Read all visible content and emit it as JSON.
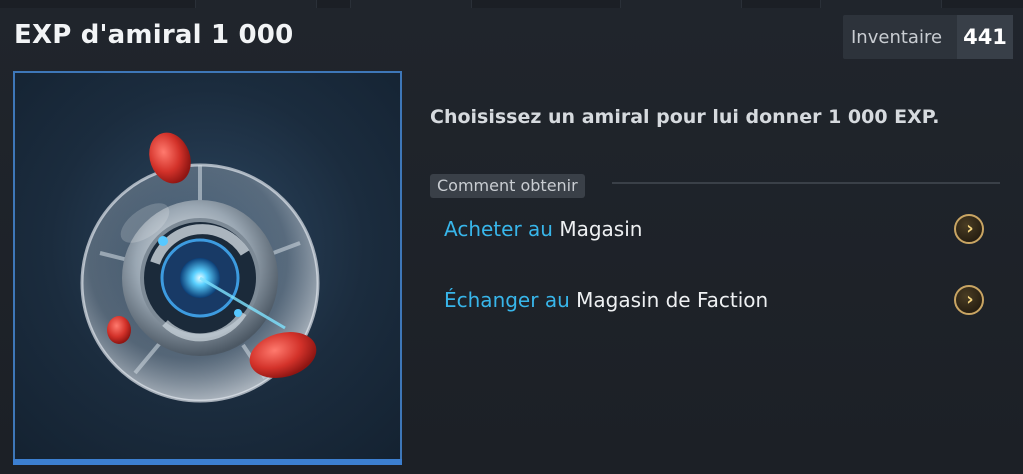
{
  "window": {
    "title": "EXP d'amiral 1 000",
    "inventory_label": "Inventaire",
    "inventory_value": "441"
  },
  "item": {
    "icon": "admiral-exp-orb-icon",
    "description": "Choisissez un amiral pour lui donner 1 000 EXP."
  },
  "obtain": {
    "section_label": "Comment obtenir",
    "options": [
      {
        "action": "Acheter au",
        "target": "Magasin",
        "icon": "chevron-right-icon"
      },
      {
        "action": "Échanger au",
        "target": "Magasin de Faction",
        "icon": "chevron-right-icon"
      }
    ]
  },
  "colors": {
    "accent_blue": "#38b6ea",
    "frame_blue": "#3e77b8",
    "gold": "#c9a563"
  }
}
